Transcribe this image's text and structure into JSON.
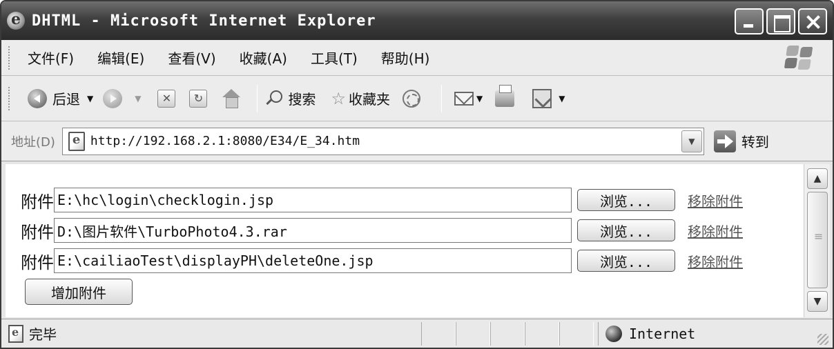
{
  "window": {
    "title": "DHTML - Microsoft Internet Explorer"
  },
  "menu": {
    "items": [
      "文件(F)",
      "编辑(E)",
      "查看(V)",
      "收藏(A)",
      "工具(T)",
      "帮助(H)"
    ]
  },
  "toolbar": {
    "back_label": "后退",
    "search_label": "搜索",
    "favorites_label": "收藏夹"
  },
  "address": {
    "label": "地址(D)",
    "url": "http://192.168.2.1:8080/E34/E_34.htm",
    "go_label": "转到"
  },
  "form": {
    "attachments": [
      {
        "label": "附件",
        "value": "E:\\hc\\login\\checklogin.jsp",
        "browse": "浏览...",
        "remove": "移除附件"
      },
      {
        "label": "附件",
        "value": "D:\\图片软件\\TurboPhoto4.3.rar",
        "browse": "浏览...",
        "remove": "移除附件"
      },
      {
        "label": "附件",
        "value": "E:\\cailiaoTest\\displayPH\\deleteOne.jsp",
        "browse": "浏览...",
        "remove": "移除附件"
      }
    ],
    "add_button": "增加附件"
  },
  "status": {
    "text": "完毕",
    "zone": "Internet"
  }
}
